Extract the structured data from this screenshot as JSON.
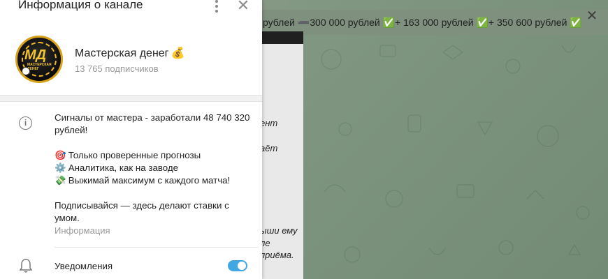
{
  "background": {
    "pinned_text": "рублей ➖300 000 рублей ✅+ 163 000 рублей ✅+ 350 600 рублей ✅",
    "close_glyph": "✕",
    "message_fragments": [
      "ент",
      "аёт",
      "ыши ему",
      "ле",
      "приёма."
    ]
  },
  "panel": {
    "title": "Информация о канале",
    "close_glyph": "✕",
    "avatar": {
      "logo_text": "МД",
      "logo_sub": "МАСТЕРСКАЯ ДЕНЕГ"
    },
    "channel_name": "Мастерская денег",
    "channel_emoji": "💰",
    "subscribers": "13 765 подписчиков",
    "description": {
      "line1": "Сигналы от мастера - заработали 48 740 320 рублей!",
      "bullets": [
        {
          "emoji": "🎯",
          "text": "Только проверенные прогнозы"
        },
        {
          "emoji": "⚙️",
          "text": "Аналитика, как на заводе"
        },
        {
          "emoji": "💸",
          "text": "Выжимай максимум с каждого матча!"
        }
      ],
      "closing": "Подписывайся — здесь делают ставки с умом."
    },
    "info_label": "Информация",
    "notifications_label": "Уведомления",
    "notifications_on": true
  },
  "colors": {
    "accent": "#40a7e3",
    "chat_bg": "#7f957f"
  }
}
